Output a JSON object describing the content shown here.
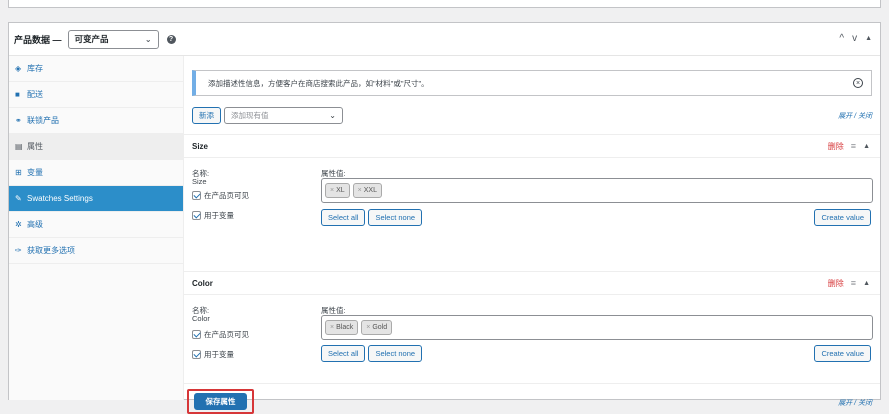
{
  "header": {
    "title": "产品数据 —",
    "product_type": "可变产品",
    "help": "?",
    "arrow_up": "^",
    "arrow_down": "v",
    "arrow_toggle": "▲"
  },
  "tabs": [
    {
      "icon": "◈",
      "label": "库存"
    },
    {
      "icon": "■",
      "label": "配送"
    },
    {
      "icon": "⚭",
      "label": "联锁产品"
    },
    {
      "icon": "▤",
      "label": "属性"
    },
    {
      "icon": "⊞",
      "label": "变量"
    },
    {
      "icon": "✎",
      "label": "Swatches Settings"
    },
    {
      "icon": "✲",
      "label": "高级"
    },
    {
      "icon": "✑",
      "label": "获取更多选项"
    }
  ],
  "notice": {
    "text": "添加描述性信息，方便客户在商店搜索此产品，如\"材料\"或\"尺寸\"。",
    "close": "×"
  },
  "toolbar": {
    "add_button": "新添",
    "select_placeholder": "添加现有值",
    "expand_collapse": "展开 / 关闭"
  },
  "attributes": [
    {
      "name": "Size",
      "remove": "删除",
      "name_label": "名称:",
      "name_value": "Size",
      "values_label": "属性值:",
      "values": [
        "XL",
        "XXL"
      ],
      "visible_label": "在产品页可见",
      "variation_label": "用于变量",
      "select_all": "Select all",
      "select_none": "Select none",
      "create_value": "Create value"
    },
    {
      "name": "Color",
      "remove": "删除",
      "name_label": "名称:",
      "name_value": "Color",
      "values_label": "属性值:",
      "values": [
        "Black",
        "Gold"
      ],
      "visible_label": "在产品页可见",
      "variation_label": "用于变量",
      "select_all": "Select all",
      "select_none": "Select none",
      "create_value": "Create value"
    }
  ],
  "footer": {
    "save_button": "保存属性",
    "expand_collapse": "展开 / 关闭"
  },
  "colors": {
    "accent": "#2271b1",
    "active_tab": "#2c8ec9",
    "remove": "#d63638",
    "highlight_border": "#d63638"
  },
  "token_remove": "×",
  "menu_icon": "≡",
  "chevron": "⌄"
}
